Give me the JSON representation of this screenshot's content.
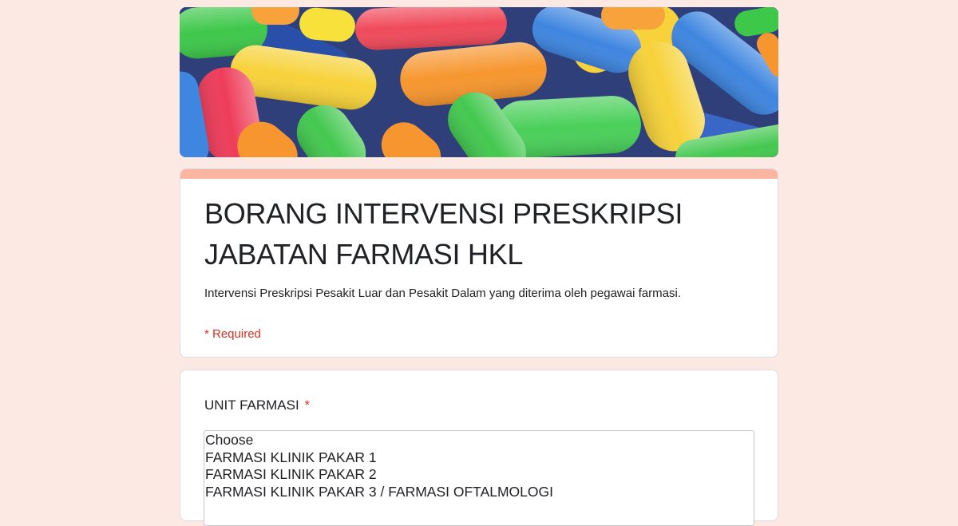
{
  "banner": {
    "alt": "colorful candy banner"
  },
  "form": {
    "title": "BORANG INTERVENSI PRESKRIPSI JABATAN FARMASI HKL",
    "description": "Intervensi Preskripsi Pesakit Luar dan Pesakit Dalam yang diterima oleh pegawai farmasi.",
    "required_note": "* Required",
    "accent_color": "#fbb5a0",
    "background_color": "#fde9e4"
  },
  "question": {
    "label": "UNIT FARMASI",
    "required_star": "*",
    "options": [
      "Choose",
      "FARMASI KLINIK PAKAR 1",
      "FARMASI KLINIK PAKAR 2",
      "FARMASI KLINIK PAKAR 3 / FARMASI OFTALMOLOGI"
    ]
  }
}
